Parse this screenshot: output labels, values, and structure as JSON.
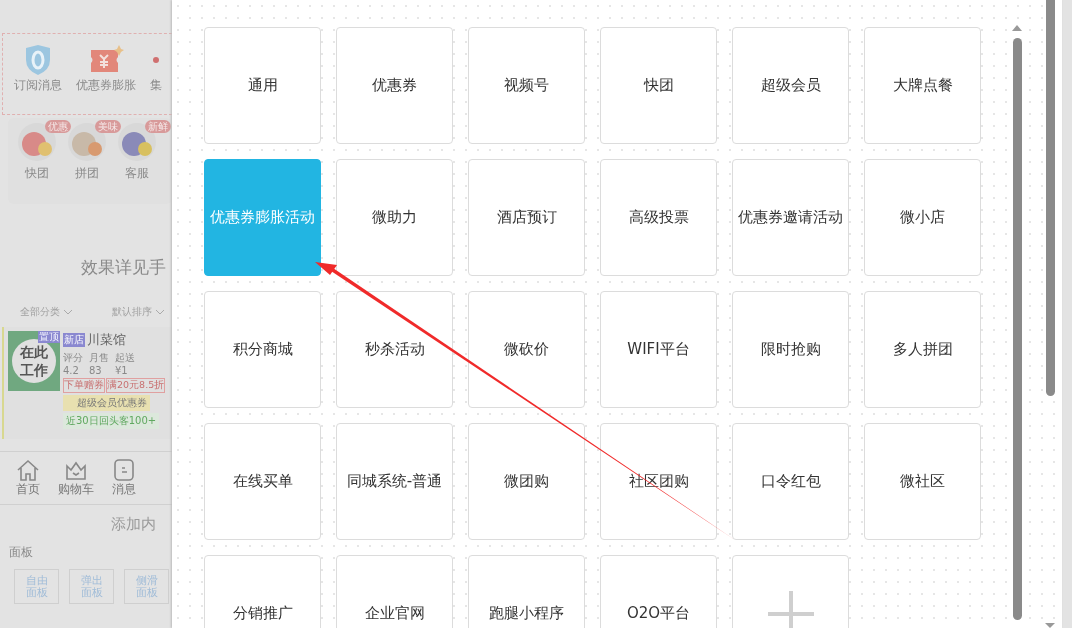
{
  "background_page": {
    "quick_icons": [
      {
        "label": "订阅消息",
        "kind": "shield"
      },
      {
        "label": "优惠券膨胀",
        "kind": "ticket"
      },
      {
        "label": "集",
        "kind": "dot"
      }
    ],
    "features": [
      {
        "label": "快团",
        "badge": "优惠"
      },
      {
        "label": "拼团",
        "badge": "美味"
      },
      {
        "label": "客服",
        "badge": "新鲜"
      }
    ],
    "notice": "效果详见手",
    "filters": [
      "全部分类",
      "默认排序"
    ],
    "store": {
      "image_text": "在此工作",
      "top_badge": "置顶",
      "new_badge": "新店",
      "name": "川菜馆",
      "stats": [
        {
          "label": "评分",
          "value": "4.2"
        },
        {
          "label": "月售",
          "value": "83"
        },
        {
          "label": "起送",
          "value": "¥1"
        }
      ],
      "coupons": [
        "下单赠券",
        "满20元8.5折"
      ],
      "vip": "超级会员优惠券",
      "highlight": "近30日回头客100+"
    },
    "tabbar": [
      {
        "label": "首页",
        "kind": "home"
      },
      {
        "label": "购物车",
        "kind": "basket"
      },
      {
        "label": "消息",
        "kind": "message"
      }
    ],
    "add_title": "添加内",
    "panel_label": "面板",
    "panel_buttons": [
      "自由面板",
      "弹出面板",
      "侧滑面板"
    ]
  },
  "modules": [
    {
      "kind": "text",
      "label": "通用",
      "selected": false
    },
    {
      "kind": "text",
      "label": "优惠券",
      "selected": false
    },
    {
      "kind": "text",
      "label": "视频号",
      "selected": false
    },
    {
      "kind": "text",
      "label": "快团",
      "selected": false
    },
    {
      "kind": "text",
      "label": "超级会员",
      "selected": false
    },
    {
      "kind": "text",
      "label": "大牌点餐",
      "selected": false
    },
    {
      "kind": "text",
      "label": "优惠券膨胀活动",
      "selected": true
    },
    {
      "kind": "text",
      "label": "微助力",
      "selected": false
    },
    {
      "kind": "text",
      "label": "酒店预订",
      "selected": false
    },
    {
      "kind": "text",
      "label": "高级投票",
      "selected": false
    },
    {
      "kind": "text",
      "label": "优惠券邀请活动",
      "selected": false
    },
    {
      "kind": "text",
      "label": "微小店",
      "selected": false
    },
    {
      "kind": "text",
      "label": "积分商城",
      "selected": false
    },
    {
      "kind": "text",
      "label": "秒杀活动",
      "selected": false
    },
    {
      "kind": "text",
      "label": "微砍价",
      "selected": false
    },
    {
      "kind": "text",
      "label": "WIFI平台",
      "selected": false
    },
    {
      "kind": "text",
      "label": "限时抢购",
      "selected": false
    },
    {
      "kind": "text",
      "label": "多人拼团",
      "selected": false
    },
    {
      "kind": "text",
      "label": "在线买单",
      "selected": false
    },
    {
      "kind": "text",
      "label": "同城系统-普通",
      "selected": false
    },
    {
      "kind": "text",
      "label": "微团购",
      "selected": false
    },
    {
      "kind": "text",
      "label": "社区团购",
      "selected": false
    },
    {
      "kind": "text",
      "label": "口令红包",
      "selected": false
    },
    {
      "kind": "text",
      "label": "微社区",
      "selected": false
    },
    {
      "kind": "text",
      "label": "分销推广",
      "selected": false
    },
    {
      "kind": "text",
      "label": "企业官网",
      "selected": false
    },
    {
      "kind": "text",
      "label": "跑腿小程序",
      "selected": false
    },
    {
      "kind": "text",
      "label": "O2O平台",
      "selected": false
    },
    {
      "kind": "add",
      "selected": false
    }
  ]
}
